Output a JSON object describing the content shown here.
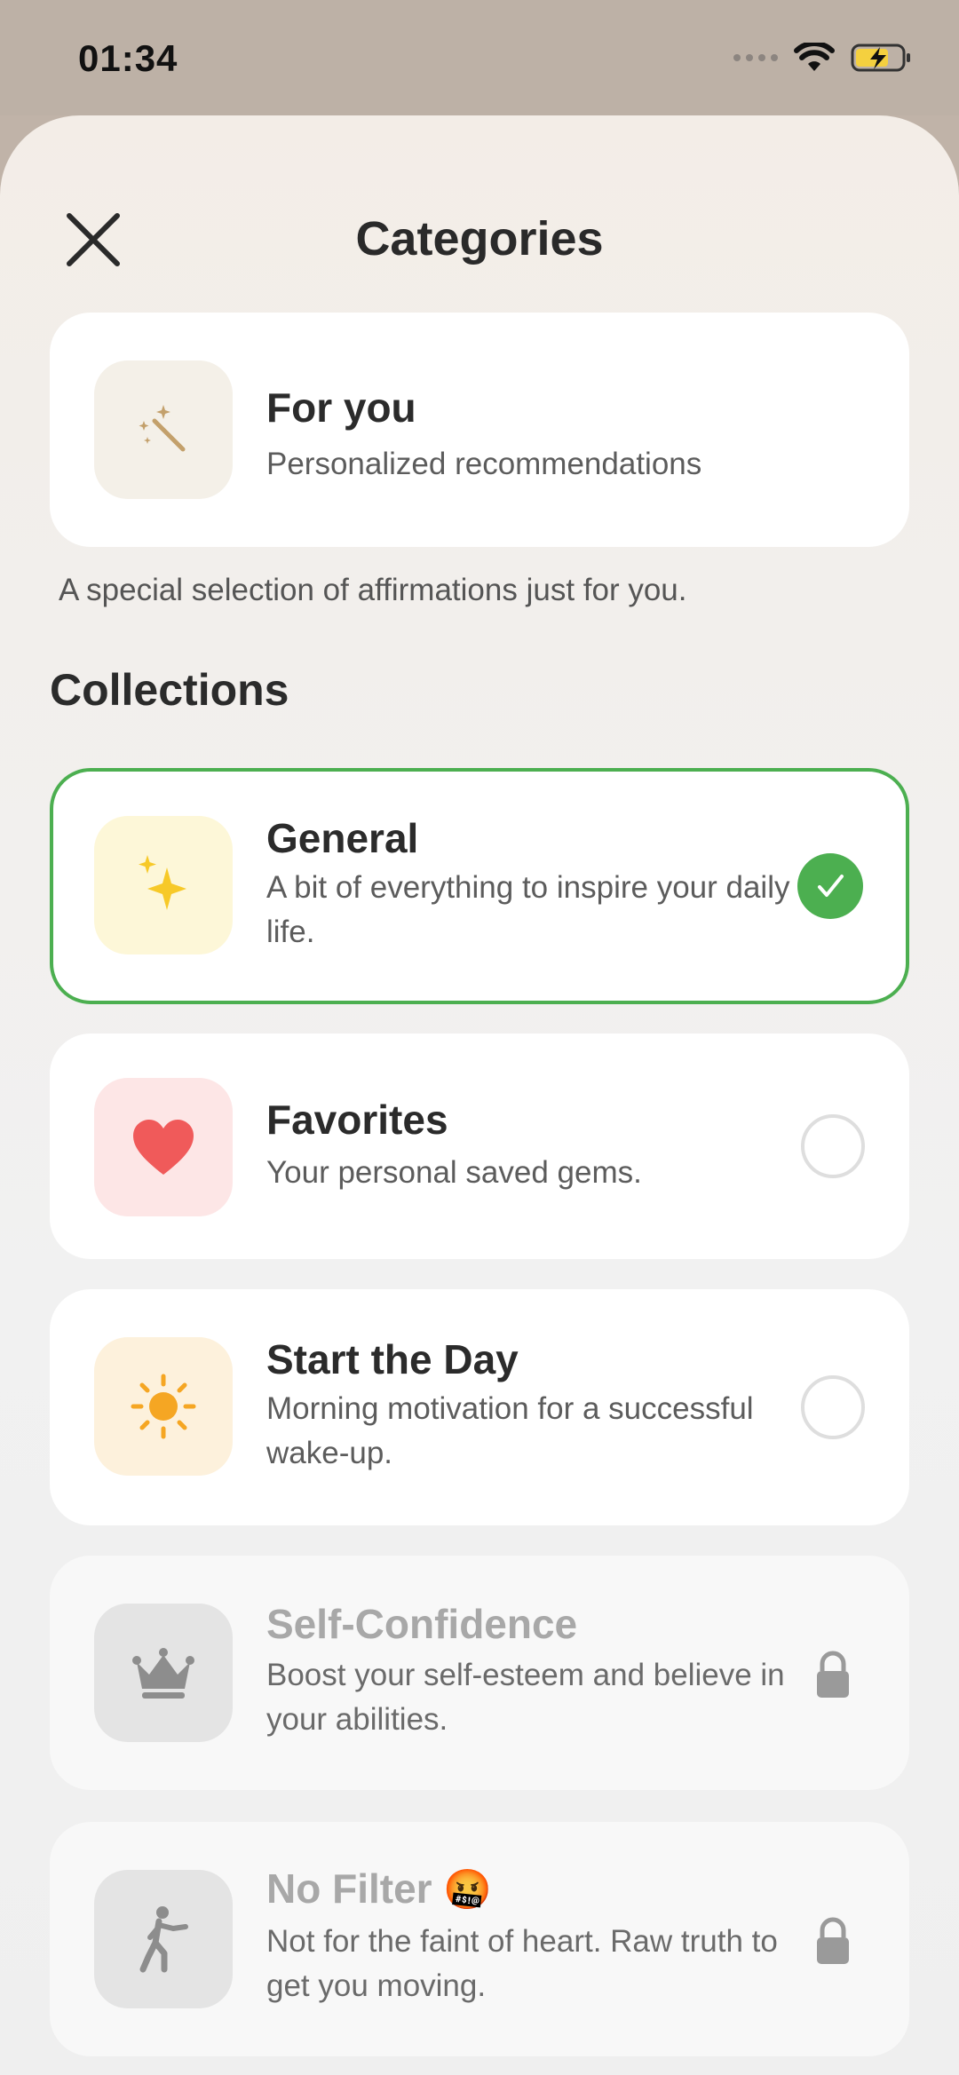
{
  "status_bar": {
    "time": "01:34"
  },
  "header": {
    "title": "Categories"
  },
  "for_you": {
    "title": "For you",
    "subtitle": "Personalized recommendations",
    "note": "A special selection of affirmations just for you."
  },
  "collections": {
    "heading": "Collections",
    "items": [
      {
        "title": "General",
        "desc": "A bit of everything to inspire your daily life.",
        "state": "selected",
        "icon": "sparkles-icon"
      },
      {
        "title": "Favorites",
        "desc": "Your personal saved gems.",
        "state": "unselected",
        "icon": "heart-icon"
      },
      {
        "title": "Start the Day",
        "desc": "Morning motivation for a successful wake-up.",
        "state": "unselected",
        "icon": "sun-icon"
      },
      {
        "title": "Self-Confidence",
        "desc": "Boost your self-esteem and believe in your abilities.",
        "state": "locked",
        "icon": "crown-icon"
      },
      {
        "title": "No Filter",
        "title_emoji": "🤬",
        "desc": "Not for the faint of heart. Raw truth to get you moving.",
        "state": "locked",
        "icon": "running-person-icon"
      }
    ]
  },
  "colors": {
    "accent_green": "#4caf50",
    "heart_red": "#f05a5a",
    "sun_orange": "#f5a623",
    "sparkle_yellow": "#f7c928"
  }
}
